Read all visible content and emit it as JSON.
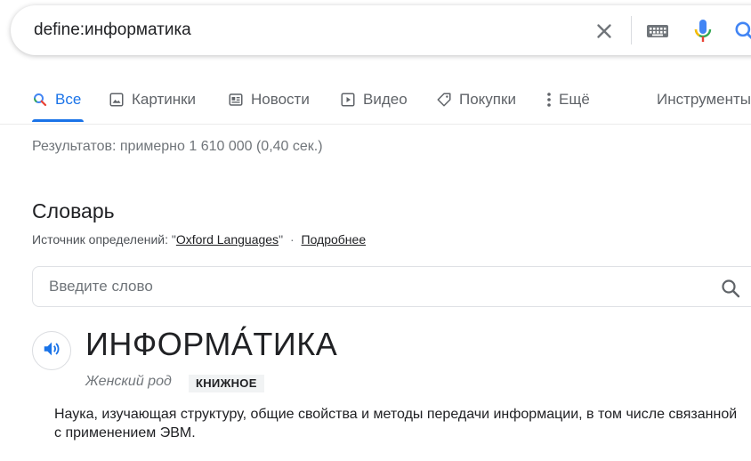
{
  "search": {
    "query": "define:информатика"
  },
  "tabs": [
    {
      "label": "Все",
      "icon": "search-icon"
    },
    {
      "label": "Картинки",
      "icon": "image-icon"
    },
    {
      "label": "Новости",
      "icon": "news-icon"
    },
    {
      "label": "Видео",
      "icon": "play-icon"
    },
    {
      "label": "Покупки",
      "icon": "tag-icon"
    },
    {
      "label": "Ещё",
      "icon": "more-vert-icon"
    },
    {
      "label": "Инструменты"
    }
  ],
  "stats": "Результатов: примерно 1 610 000 (0,40 сек.)",
  "dictionary": {
    "title": "Словарь",
    "source_prefix": "Источник определений: \"",
    "source_name": "Oxford Languages",
    "source_suffix": "\"",
    "separator": "·",
    "more_link": "Подробнее",
    "input_placeholder": "Введите слово",
    "headword": "ИНФОРМА́ТИКА",
    "gender": "Женский род",
    "register_badge": "КНИЖНОЕ",
    "definition": "Наука, изучающая структуру, общие свойства и методы передачи информации, в том числе связанной с применением ЭВМ."
  },
  "colors": {
    "accent": "#1a73e8",
    "text": "#202124",
    "muted": "#70757a",
    "mic_red": "#ea4335",
    "mic_yellow": "#fbbc04",
    "mic_green": "#34a853"
  }
}
